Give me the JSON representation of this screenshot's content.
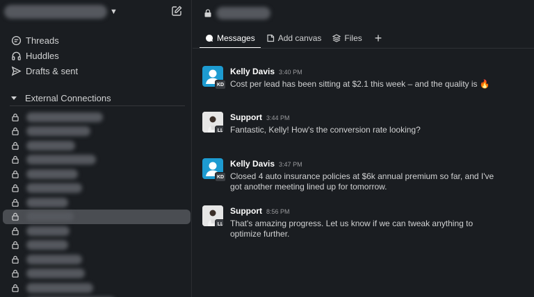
{
  "sidebar": {
    "nav": [
      {
        "label": "Threads",
        "icon": "threads-icon"
      },
      {
        "label": "Huddles",
        "icon": "headphones-icon"
      },
      {
        "label": "Drafts & sent",
        "icon": "send-icon"
      }
    ],
    "section_title": "External Connections",
    "channel_count": 14,
    "active_channel_index": 7
  },
  "main": {
    "tabs": [
      {
        "label": "Messages",
        "icon": "message-icon",
        "active": true
      },
      {
        "label": "Add canvas",
        "icon": "canvas-icon",
        "active": false
      },
      {
        "label": "Files",
        "icon": "files-icon",
        "active": false
      }
    ],
    "messages": [
      {
        "sender": "Kelly Davis",
        "time": "3:40 PM",
        "initials": "KD",
        "text": "Cost per lead has been sitting at $2.1 this week – and the quality is 🔥"
      },
      {
        "sender": "Support",
        "time": "3:44 PM",
        "initials": "LL",
        "text": "Fantastic, Kelly! How's the conversion rate looking?"
      },
      {
        "sender": "Kelly Davis",
        "time": "3:47 PM",
        "initials": "KD",
        "text": "Closed 4 auto insurance policies at $6k annual premium so far, and I've got another meeting lined up for tomorrow."
      },
      {
        "sender": "Support",
        "time": "8:56 PM",
        "initials": "LL",
        "text": "That's amazing progress. Let us know if we can tweak anything to optimize further."
      }
    ]
  },
  "colors": {
    "accent": "#1d9bd1",
    "background": "#1a1d21",
    "active_row": "#4a4d52"
  }
}
